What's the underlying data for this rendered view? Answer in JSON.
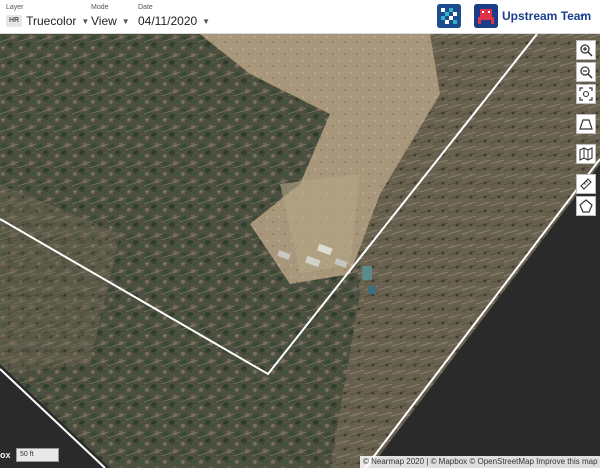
{
  "header": {
    "layer": {
      "label": "Layer",
      "badge": "HR",
      "value": "Truecolor"
    },
    "mode": {
      "label": "Mode",
      "value": "View"
    },
    "date": {
      "label": "Date",
      "value": "04/11/2020"
    },
    "team": {
      "name": "Upstream Team"
    }
  },
  "toolbar": {
    "tools": [
      {
        "name": "zoom-in",
        "icon": "zoom-in-icon"
      },
      {
        "name": "zoom-out",
        "icon": "zoom-out-icon"
      },
      {
        "name": "zoom-extent",
        "icon": "fit-extent-icon"
      },
      {
        "name": "measure-area",
        "icon": "trapezoid-icon"
      },
      {
        "name": "map-style",
        "icon": "map-icon"
      },
      {
        "name": "measure-distance",
        "icon": "ruler-icon"
      },
      {
        "name": "draw-polygon",
        "icon": "polygon-icon"
      }
    ]
  },
  "map": {
    "box_label": "ox",
    "scale_label": "50 ft",
    "attribution": "© Nearmap 2020 | © Mapbox © OpenStreetMap Improve this map",
    "colors": {
      "forest": "#4a4d3c",
      "clearing": "#a89a7c",
      "boundary": "#ffffff",
      "outside": "#2a2a2a"
    }
  }
}
